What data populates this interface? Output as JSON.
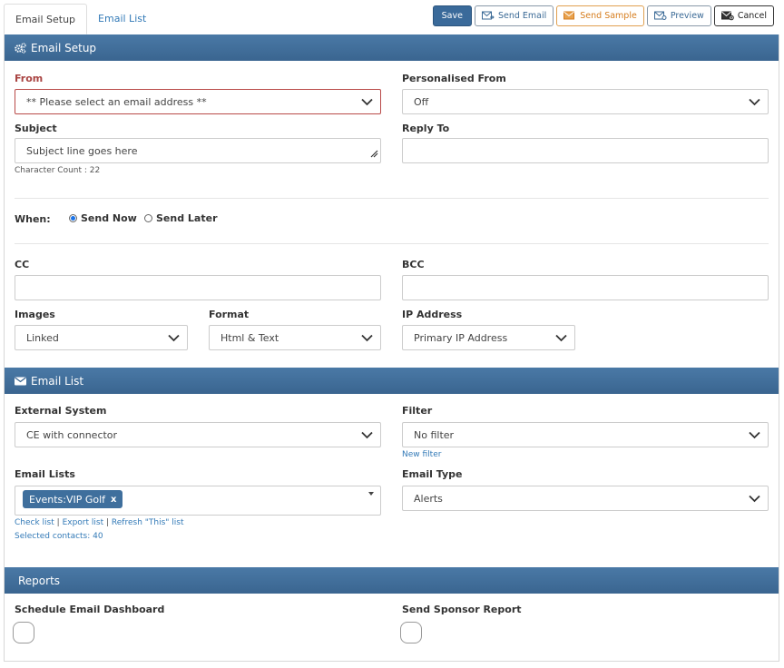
{
  "tabs": [
    {
      "label": "Email Setup"
    },
    {
      "label": "Email List"
    }
  ],
  "toolbar": {
    "save": "Save",
    "send_email": "Send Email",
    "send_sample": "Send Sample",
    "preview": "Preview",
    "cancel": "Cancel"
  },
  "setup": {
    "title": "Email Setup",
    "from_label": "From",
    "from_value": "** Please select an email address **",
    "personalised_label": "Personalised From",
    "personalised_value": "Off",
    "subject_label": "Subject",
    "subject_placeholder": "Subject line goes here",
    "char_count": "Character Count : 22",
    "reply_label": "Reply To",
    "reply_value": "",
    "when_label": "When:",
    "send_now": "Send Now",
    "send_later": "Send Later",
    "cc_label": "CC",
    "bcc_label": "BCC",
    "images_label": "Images",
    "images_value": "Linked",
    "format_label": "Format",
    "format_value": "Html & Text",
    "ip_label": "IP Address",
    "ip_value": "Primary IP Address"
  },
  "list": {
    "title": "Email List",
    "external_label": "External System",
    "external_value": "CE with connector",
    "filter_label": "Filter",
    "filter_value": "No filter",
    "new_filter": "New filter",
    "lists_label": "Email Lists",
    "list_tag": "Events:VIP Golf",
    "tag_remove": "x",
    "check_list": "Check list",
    "export_list": "Export list",
    "refresh_list": "Refresh \"This\" list",
    "sep": "|",
    "selected": "Selected contacts: 40",
    "type_label": "Email Type",
    "type_value": "Alerts"
  },
  "reports": {
    "title": "Reports",
    "schedule_label": "Schedule Email Dashboard",
    "sponsor_label": "Send Sponsor Report"
  },
  "colors": {
    "header": "#3d6b97",
    "accent": "#337ab7",
    "error": "#a94442",
    "warning": "#d67d1e"
  }
}
